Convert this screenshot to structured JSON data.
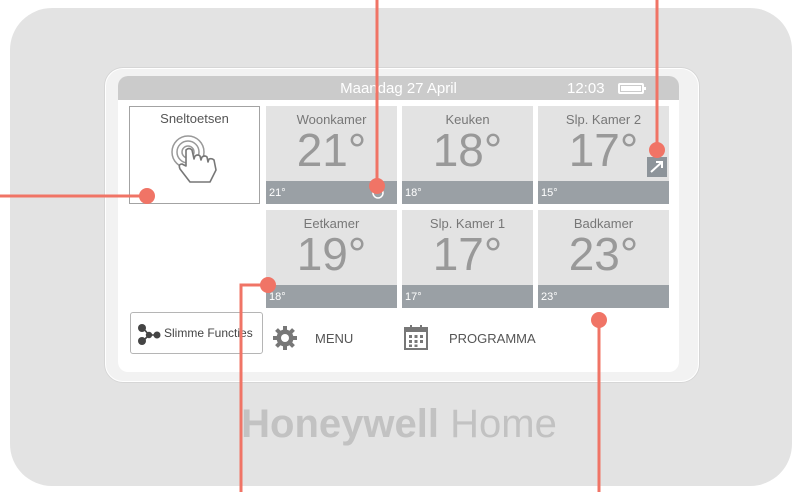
{
  "status_bar": {
    "date": "Maandag 27 April",
    "time": "12:03"
  },
  "shortcuts": {
    "label": "Sneltoetsen"
  },
  "zones": [
    {
      "name": "Woonkamer",
      "temp": "21°",
      "setpoint": "21°"
    },
    {
      "name": "Keuken",
      "temp": "18°",
      "setpoint": "18°"
    },
    {
      "name": "Slp. Kamer 2",
      "temp": "17°",
      "setpoint": "15°"
    },
    {
      "name": "Eetkamer",
      "temp": "19°",
      "setpoint": "18°"
    },
    {
      "name": "Slp. Kamer 1",
      "temp": "17°",
      "setpoint": "17°"
    },
    {
      "name": "Badkamer",
      "temp": "23°",
      "setpoint": "23°"
    }
  ],
  "bottom_bar": {
    "smart_label": "Slimme Functies",
    "menu_label": "MENU",
    "program_label": "PROGRAMMA"
  },
  "brand": {
    "bold": "Honeywell",
    "light": "Home"
  },
  "colors": {
    "callout": "#f07466",
    "tile_bg": "#e3e3e3",
    "tile_footer": "#9aa0a5",
    "status_bar": "#cbcbcb"
  },
  "icons": {
    "shortcut": "touch-hand-icon",
    "smart": "smart-functions-icon",
    "menu": "gear-icon",
    "program": "calendar-icon",
    "boost": "trend-arrow-icon",
    "timer": "timer-icon"
  }
}
